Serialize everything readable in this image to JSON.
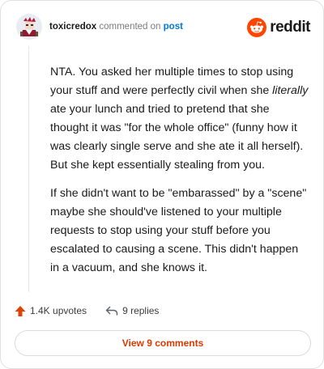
{
  "comment": {
    "username": "toxicredox",
    "action_text": "commented on",
    "target_link": "post",
    "paragraphs": [
      {
        "before": "NTA. You asked her multiple times to stop using your stuff and were perfectly civil when she ",
        "emphasis": "literally",
        "after": " ate your lunch and tried to pretend that she thought it was \"for the whole office\" (funny how it was clearly single serve and she ate it all herself). But she kept essentially stealing from you."
      },
      {
        "text": "If she didn't want to be \"embarassed\" by a \"scene\" maybe she should've listened to your multiple requests to stop using your stuff before you escalated to causing a scene. This didn't happen in a vacuum, and she knows it."
      }
    ]
  },
  "brand": {
    "wordmark": "reddit",
    "color": "#ff4500",
    "icon": "reddit-snoo-icon"
  },
  "actions": {
    "upvotes_label": "1.4K upvotes",
    "replies_label": "9 replies",
    "upvote_icon": "upvote-arrow-icon",
    "reply_icon": "reply-arrow-icon"
  },
  "view_comments_label": "View 9 comments"
}
